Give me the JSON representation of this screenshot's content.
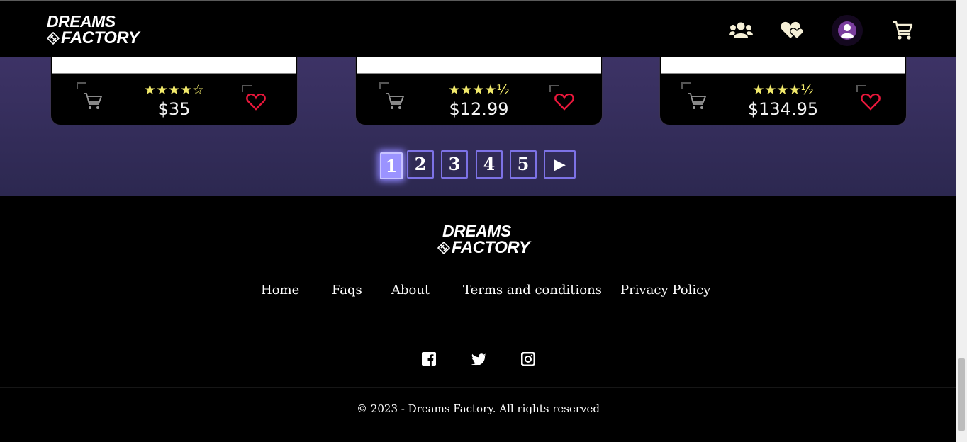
{
  "brand": {
    "line1": "DREAMS",
    "line2": "FACTORY"
  },
  "header_icons": [
    "users-icon",
    "hearts-icon",
    "avatar-icon",
    "cart-icon"
  ],
  "products": [
    {
      "rating_stars": "★★★★☆",
      "rating": 4,
      "price": "$35"
    },
    {
      "rating_stars": "★★★★½",
      "rating": 4.5,
      "price": "$12.99"
    },
    {
      "rating_stars": "★★★★½",
      "rating": 4.5,
      "price": "$134.95"
    }
  ],
  "pagination": {
    "pages": [
      "1",
      "2",
      "3",
      "4",
      "5"
    ],
    "current": "1",
    "next_label": "▶"
  },
  "footer": {
    "links": [
      "Home",
      "Faqs",
      "About",
      "Terms and conditions",
      "Privacy Policy"
    ],
    "social": [
      "facebook-icon",
      "twitter-icon",
      "instagram-icon"
    ],
    "copyright": "© 2023 - Dreams Factory. All rights reserved"
  },
  "colors": {
    "accent": "#7d72e6",
    "heart": "#e8173b",
    "star": "#f2ea6b",
    "band": "#3d3366"
  }
}
